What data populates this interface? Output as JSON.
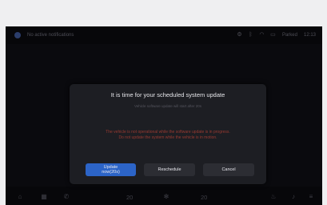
{
  "status_bar": {
    "message": "No active notifications",
    "right_label": "Parked",
    "time": "12:13"
  },
  "dialog": {
    "title": "It is time for your scheduled system update",
    "subtitle": "Vehicle software update will start after 20s",
    "warning_line1": "The vehicle is not operational while the software update is in progress.",
    "warning_line2": "Do not update the system while the vehicle is in motion.",
    "buttons": {
      "update_now_line1": "Update",
      "update_now_line2": "now(20s)",
      "reschedule": "Reschedule",
      "cancel": "Cancel"
    }
  },
  "dock": {
    "driver_temp": "20",
    "passenger_temp": "20"
  },
  "colors": {
    "primary_button": "#2c64c7",
    "warning_text": "#9a3a31"
  },
  "icons": [
    "user-avatar",
    "settings",
    "bluetooth",
    "wifi",
    "battery",
    "home",
    "apps",
    "phone",
    "fan",
    "seat-heat",
    "volume"
  ]
}
